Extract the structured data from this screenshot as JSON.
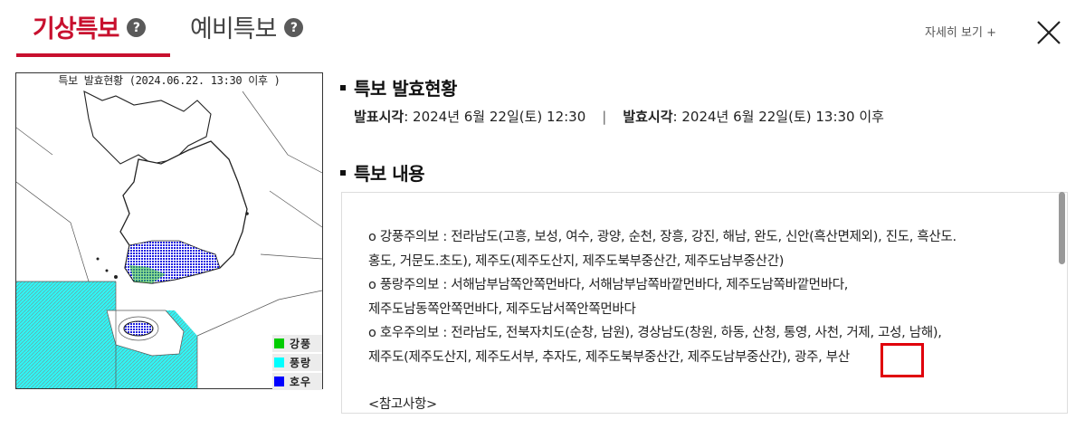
{
  "tabs": {
    "main_label": "기상특보",
    "sub_label": "예비특보",
    "help_symbol": "?"
  },
  "header": {
    "detail_link": "자세히 보기 +"
  },
  "map": {
    "title": "특보 발효현황 (2024.06.22. 13:30 이후 )",
    "legend": [
      {
        "label": "강풍",
        "color": "#00cc00"
      },
      {
        "label": "풍랑",
        "color": "#00ffff"
      },
      {
        "label": "호우",
        "color": "#0000ff"
      }
    ]
  },
  "status": {
    "section_title": "특보 발효현황",
    "announce_label": "발표시각",
    "announce_value": " : 2024년 6월 22일(토) 12:30",
    "separator": "|",
    "effective_label": "발효시각",
    "effective_value": " : 2024년 6월 22일(토) 13:30 이후"
  },
  "content": {
    "section_title": "특보 내용",
    "lines": [
      "o 강풍주의보 : 전라남도(고흥, 보성, 여수, 광양, 순천, 장흥, 강진, 해남, 완도, 신안(흑산면제외), 진도, 흑산도.",
      "홍도, 거문도.초도), 제주도(제주도산지, 제주도북부중산간, 제주도남부중산간)",
      "o 풍랑주의보 : 서해남부남쪽안쪽먼바다, 서해남부남쪽바깥먼바다, 제주도남쪽바깥먼바다,",
      "제주도남동쪽안쪽먼바다, 제주도남서쪽안쪽먼바다",
      "o 호우주의보 : 전라남도, 전북자치도(순창, 남원), 경상남도(창원, 하동, 산청, 통영, 사천, 거제, 고성, 남해),",
      "제주도(제주도산지, 제주도서부, 추자도, 제주도북부중산간, 제주도남부중산간), 광주, 부산"
    ],
    "reference": "<참고사항>"
  },
  "colors": {
    "accent": "#c8102e",
    "highlight": "#e0000b"
  }
}
